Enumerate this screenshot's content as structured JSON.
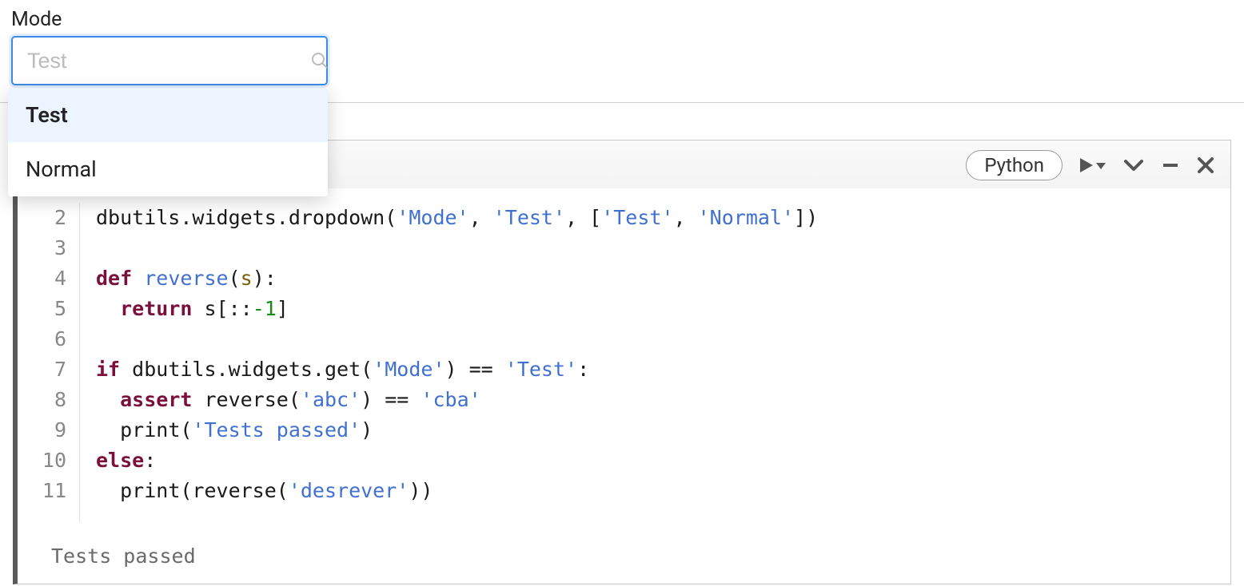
{
  "widget": {
    "label": "Mode",
    "placeholder": "Test",
    "options": [
      "Test",
      "Normal"
    ],
    "selected": "Test"
  },
  "cell": {
    "language": "Python",
    "line_numbers": [
      "2",
      "3",
      "4",
      "5",
      "6",
      "7",
      "8",
      "9",
      "10",
      "11"
    ],
    "code": {
      "l2_a": "dbutils.widgets.dropdown(",
      "l2_s1": "'Mode'",
      "l2_p1": ", ",
      "l2_s2": "'Test'",
      "l2_p2": ", [",
      "l2_s3": "'Test'",
      "l2_p3": ", ",
      "l2_s4": "'Normal'",
      "l2_p4": "])",
      "l4_kw": "def",
      "l4_sp": " ",
      "l4_fn": "reverse",
      "l4_p1": "(",
      "l4_param": "s",
      "l4_p2": "):",
      "l5_indent": "  ",
      "l5_kw": "return",
      "l5_rest": " s[::",
      "l5_num": "-1",
      "l5_p": "]",
      "l7_kw": "if",
      "l7_a": " dbutils.widgets.get(",
      "l7_s1": "'Mode'",
      "l7_p1": ") == ",
      "l7_s2": "'Test'",
      "l7_p2": ":",
      "l8_indent": "  ",
      "l8_kw": "assert",
      "l8_a": " reverse(",
      "l8_s1": "'abc'",
      "l8_p1": ") == ",
      "l8_s2": "'cba'",
      "l9_indent": "  ",
      "l9_a": "print(",
      "l9_s1": "'Tests passed'",
      "l9_p1": ")",
      "l10_kw": "else",
      "l10_p": ":",
      "l11_indent": "  ",
      "l11_a": "print(reverse(",
      "l11_s1": "'desrever'",
      "l11_p1": "))"
    },
    "output": "Tests passed"
  }
}
